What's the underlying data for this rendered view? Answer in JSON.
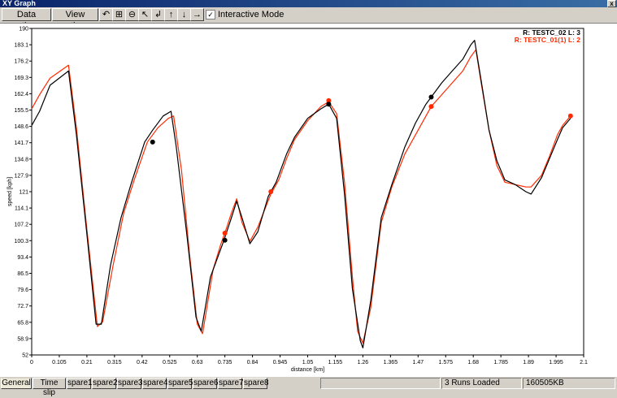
{
  "window": {
    "title": "XY Graph",
    "close_glyph": "x"
  },
  "toolbar": {
    "data_options": "Data options",
    "view_options": "View options",
    "icons": [
      {
        "name": "zoom-reset-icon",
        "glyph": "↶"
      },
      {
        "name": "zoom-box-icon",
        "glyph": "⊞"
      },
      {
        "name": "zoom-out-icon",
        "glyph": "⊖"
      },
      {
        "name": "zoom-select-icon",
        "glyph": "↖"
      },
      {
        "name": "pan-left-icon",
        "glyph": "↲"
      },
      {
        "name": "pan-up-icon",
        "glyph": "↑"
      },
      {
        "name": "pan-down-icon",
        "glyph": "↓"
      },
      {
        "name": "pan-right-icon",
        "glyph": "→"
      }
    ],
    "interactive_mode": {
      "label": "Interactive Mode",
      "checked": true
    }
  },
  "legend": [
    {
      "text": "R: TESTC_02  L: 3",
      "color": "#000000"
    },
    {
      "text": "R: TESTC_01(1)  L: 2",
      "color": "#ff2a00"
    }
  ],
  "tabs": [
    "General",
    "Time slip",
    "spare1",
    "spare2",
    "spare3",
    "spare4",
    "spare5",
    "spare6",
    "spare7",
    "spare8"
  ],
  "status": {
    "runs_loaded": "3 Runs Loaded",
    "memory": "160505KB"
  },
  "chart_data": {
    "type": "line",
    "xlabel": "distance [km]",
    "ylabel": "speed [kph]",
    "xlim": [
      0,
      2.1
    ],
    "ylim": [
      52,
      190
    ],
    "x_ticks": [
      "0",
      "0.105",
      "0.21",
      "0.315",
      "0.42",
      "0.525",
      "0.63",
      "0.735",
      "0.84",
      "0.945",
      "1.05",
      "1.155",
      "1.26",
      "1.365",
      "1.47",
      "1.575",
      "1.68",
      "1.785",
      "1.89",
      "1.995",
      "2.1"
    ],
    "y_ticks": [
      "190",
      "183.1",
      "176.2",
      "169.3",
      "162.4",
      "155.5",
      "148.6",
      "141.7",
      "134.8",
      "127.9",
      "121",
      "114.1",
      "107.2",
      "100.3",
      "93.4",
      "86.5",
      "79.6",
      "72.7",
      "65.8",
      "58.9",
      "52"
    ],
    "series": [
      {
        "name": "R: TESTC_02  L: 3",
        "color": "#000000",
        "points": [
          [
            0,
            149
          ],
          [
            0.03,
            155
          ],
          [
            0.07,
            166
          ],
          [
            0.14,
            172
          ],
          [
            0.17,
            145
          ],
          [
            0.21,
            103
          ],
          [
            0.245,
            65
          ],
          [
            0.265,
            65
          ],
          [
            0.3,
            90
          ],
          [
            0.34,
            110
          ],
          [
            0.38,
            125
          ],
          [
            0.43,
            142
          ],
          [
            0.46,
            147
          ],
          [
            0.5,
            153
          ],
          [
            0.53,
            155
          ],
          [
            0.55,
            140
          ],
          [
            0.59,
            103
          ],
          [
            0.625,
            68
          ],
          [
            0.645,
            62
          ],
          [
            0.68,
            85
          ],
          [
            0.72,
            97
          ],
          [
            0.73,
            100
          ],
          [
            0.76,
            110
          ],
          [
            0.78,
            117
          ],
          [
            0.8,
            110
          ],
          [
            0.83,
            99
          ],
          [
            0.86,
            104
          ],
          [
            0.9,
            119
          ],
          [
            0.93,
            125
          ],
          [
            0.97,
            137
          ],
          [
            1.0,
            144
          ],
          [
            1.05,
            152
          ],
          [
            1.1,
            156
          ],
          [
            1.13,
            158
          ],
          [
            1.16,
            152
          ],
          [
            1.19,
            120
          ],
          [
            1.22,
            80
          ],
          [
            1.25,
            58
          ],
          [
            1.26,
            55
          ],
          [
            1.29,
            75
          ],
          [
            1.33,
            110
          ],
          [
            1.37,
            124
          ],
          [
            1.42,
            140
          ],
          [
            1.46,
            150
          ],
          [
            1.5,
            158
          ],
          [
            1.52,
            161
          ],
          [
            1.56,
            167
          ],
          [
            1.6,
            172
          ],
          [
            1.64,
            177
          ],
          [
            1.67,
            183
          ],
          [
            1.685,
            185
          ],
          [
            1.71,
            168
          ],
          [
            1.74,
            147
          ],
          [
            1.77,
            134
          ],
          [
            1.8,
            126
          ],
          [
            1.84,
            124
          ],
          [
            1.88,
            121
          ],
          [
            1.9,
            120
          ],
          [
            1.94,
            127
          ],
          [
            1.97,
            135
          ],
          [
            2.0,
            143
          ],
          [
            2.02,
            148
          ],
          [
            2.05,
            152
          ]
        ],
        "markers": [
          [
            0.46,
            142
          ],
          [
            0.735,
            100.5
          ],
          [
            1.13,
            158
          ],
          [
            1.52,
            161
          ]
        ]
      },
      {
        "name": "R: TESTC_01(1)  L: 2",
        "color": "#ff2a00",
        "points": [
          [
            0,
            156
          ],
          [
            0.03,
            162
          ],
          [
            0.07,
            169
          ],
          [
            0.14,
            174.5
          ],
          [
            0.17,
            148
          ],
          [
            0.21,
            105
          ],
          [
            0.25,
            64
          ],
          [
            0.27,
            66
          ],
          [
            0.31,
            90
          ],
          [
            0.35,
            112
          ],
          [
            0.39,
            126
          ],
          [
            0.44,
            142
          ],
          [
            0.48,
            148
          ],
          [
            0.52,
            152
          ],
          [
            0.54,
            153
          ],
          [
            0.57,
            130
          ],
          [
            0.6,
            95
          ],
          [
            0.63,
            65
          ],
          [
            0.65,
            61
          ],
          [
            0.69,
            88
          ],
          [
            0.72,
            99
          ],
          [
            0.735,
            103.5
          ],
          [
            0.76,
            112
          ],
          [
            0.78,
            118
          ],
          [
            0.8,
            108
          ],
          [
            0.83,
            100
          ],
          [
            0.86,
            106
          ],
          [
            0.91,
            120
          ],
          [
            0.94,
            126
          ],
          [
            0.97,
            135
          ],
          [
            1.0,
            143
          ],
          [
            1.05,
            151
          ],
          [
            1.1,
            157
          ],
          [
            1.13,
            159
          ],
          [
            1.16,
            154
          ],
          [
            1.19,
            125
          ],
          [
            1.22,
            85
          ],
          [
            1.24,
            62
          ],
          [
            1.26,
            57
          ],
          [
            1.29,
            72
          ],
          [
            1.33,
            108
          ],
          [
            1.37,
            123
          ],
          [
            1.42,
            137
          ],
          [
            1.46,
            145
          ],
          [
            1.5,
            153
          ],
          [
            1.52,
            157
          ],
          [
            1.56,
            162
          ],
          [
            1.6,
            167
          ],
          [
            1.64,
            172
          ],
          [
            1.67,
            178
          ],
          [
            1.69,
            181
          ],
          [
            1.71,
            167
          ],
          [
            1.74,
            147
          ],
          [
            1.77,
            132
          ],
          [
            1.8,
            125
          ],
          [
            1.84,
            124
          ],
          [
            1.88,
            123
          ],
          [
            1.9,
            123
          ],
          [
            1.94,
            128
          ],
          [
            1.97,
            136
          ],
          [
            2.0,
            145
          ],
          [
            2.02,
            149
          ],
          [
            2.05,
            153
          ]
        ],
        "markers": [
          [
            0.735,
            103.5
          ],
          [
            0.91,
            121
          ],
          [
            1.13,
            159.5
          ],
          [
            1.52,
            157
          ],
          [
            2.05,
            153
          ]
        ]
      }
    ]
  }
}
